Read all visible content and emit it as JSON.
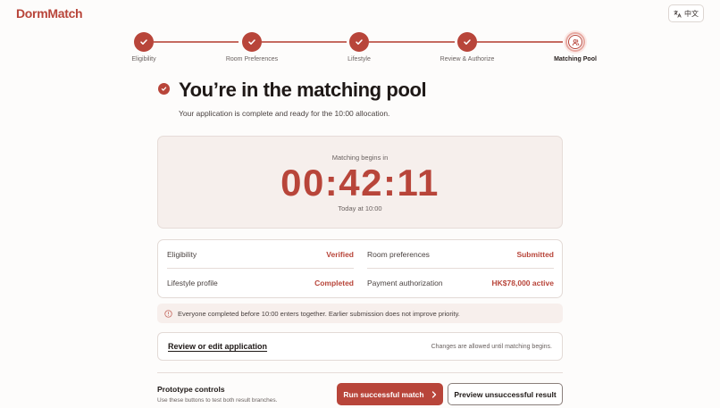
{
  "app": {
    "logo": "DormMatch",
    "language_button": "中文"
  },
  "stepper": {
    "steps": [
      {
        "label": "Eligibility",
        "state": "done"
      },
      {
        "label": "Room Preferences",
        "state": "done"
      },
      {
        "label": "Lifestyle",
        "state": "done"
      },
      {
        "label": "Review & Authorize",
        "state": "done"
      },
      {
        "label": "Matching Pool",
        "state": "current"
      }
    ]
  },
  "header": {
    "title": "You’re in the matching pool",
    "subtitle": "Your application is complete and ready for the 10:00 allocation."
  },
  "countdown": {
    "label": "Matching begins in",
    "time": "00:42:11",
    "sub": "Today at 10:00"
  },
  "status": {
    "eligibility": {
      "label": "Eligibility",
      "value": "Verified"
    },
    "room_preferences": {
      "label": "Room preferences",
      "value": "Submitted"
    },
    "lifestyle_profile": {
      "label": "Lifestyle profile",
      "value": "Completed"
    },
    "payment_authorization": {
      "label": "Payment authorization",
      "value": "HK$78,000 active"
    }
  },
  "note": {
    "text": "Everyone completed before 10:00 enters together. Earlier submission does not improve priority."
  },
  "review": {
    "link": "Review or edit application",
    "note": "Changes are allowed until matching begins."
  },
  "prototype": {
    "title": "Prototype controls",
    "subtitle": "Use these buttons to test both result branches.",
    "primary_button": "Run successful match",
    "secondary_button": "Preview unsuccessful result"
  },
  "colors": {
    "accent": "#b8453a",
    "panel": "#f6efec"
  }
}
